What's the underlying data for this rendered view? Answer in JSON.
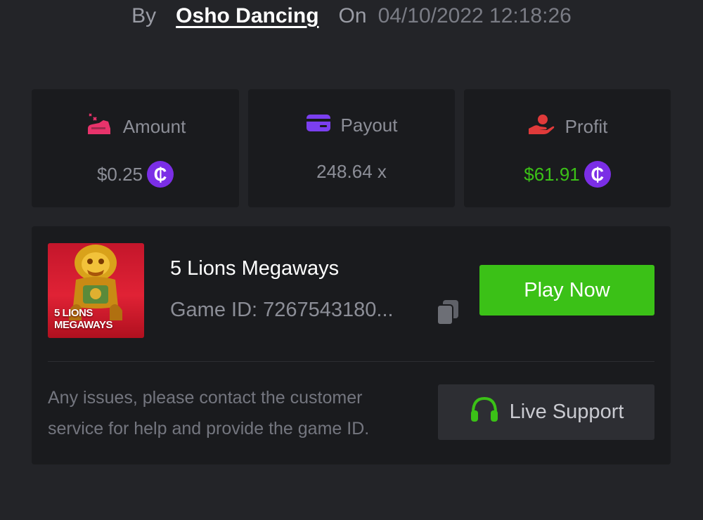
{
  "header": {
    "by_label": "By",
    "user_name": "Osho Dancing",
    "on_label": "On",
    "datetime": "04/10/2022 12:18:26"
  },
  "stats": {
    "amount": {
      "label": "Amount",
      "value": "$0.25",
      "icon": "amount-icon",
      "coin": "₵"
    },
    "payout": {
      "label": "Payout",
      "value": "248.64 x",
      "icon": "card-icon"
    },
    "profit": {
      "label": "Profit",
      "value": "$61.91",
      "icon": "hand-coin-icon",
      "coin": "₵"
    }
  },
  "game": {
    "title": "5 Lions Megaways",
    "game_id": "Game ID: 7267543180...",
    "thumbnail_text_line1": "5 LIONS",
    "thumbnail_text_line2": "MEGAWAYS",
    "play_button": "Play Now",
    "help_text_line1": "Any issues, please contact the customer",
    "help_text_line2": "service for help and provide the game ID.",
    "support_button": "Live Support"
  },
  "colors": {
    "background": "#232428",
    "card": "#1a1b1e",
    "accent_green": "#3bc117",
    "coin_purple": "#7b2ee6",
    "amount_icon": "#e8336b",
    "payout_icon": "#7b3ff0",
    "profit_icon": "#e03a3a"
  }
}
